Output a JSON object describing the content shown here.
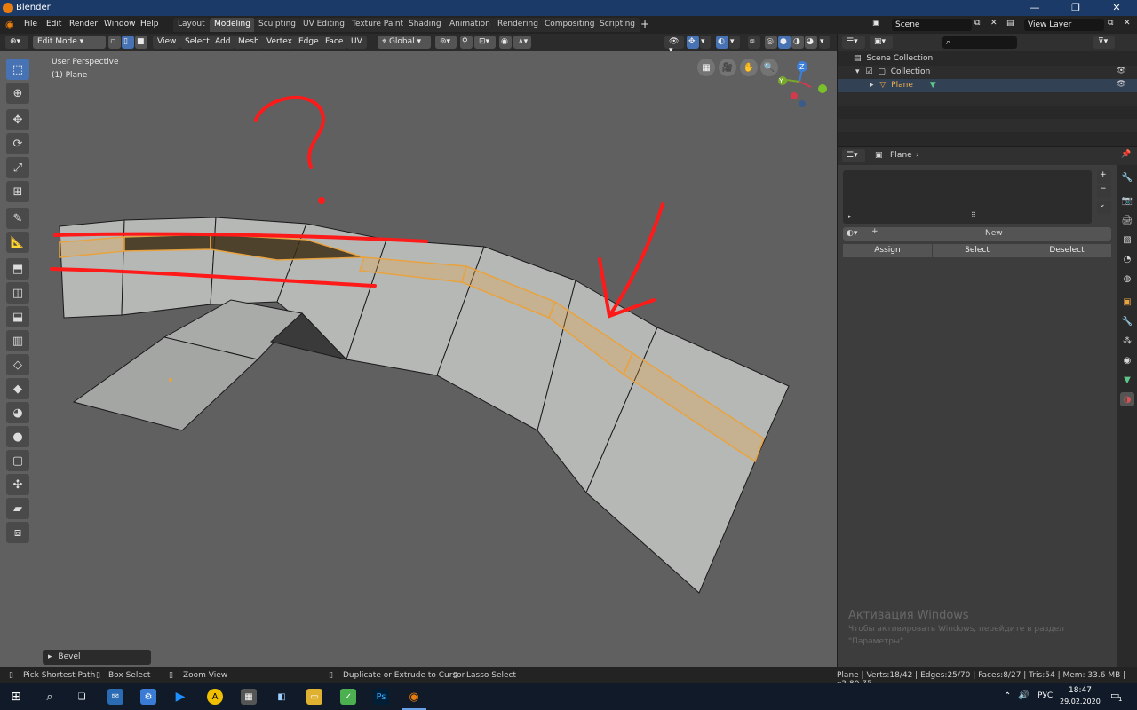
{
  "window": {
    "title": "Blender",
    "minimize": "—",
    "maximize": "❐",
    "close": "✕"
  },
  "menu": {
    "items": [
      "File",
      "Edit",
      "Render",
      "Window",
      "Help"
    ]
  },
  "workspaces": [
    "Layout",
    "Modeling",
    "Sculpting",
    "UV Editing",
    "Texture Paint",
    "Shading",
    "Animation",
    "Rendering",
    "Compositing",
    "Scripting"
  ],
  "workspace_add": "+",
  "scene": {
    "name": "Scene",
    "view_layer": "View Layer"
  },
  "viewport_header": {
    "mode": "Edit Mode",
    "menus": [
      "View",
      "Select",
      "Add",
      "Mesh",
      "Vertex",
      "Edge",
      "Face",
      "UV"
    ],
    "orientation": "Global"
  },
  "viewport": {
    "perspective_label": "User Perspective",
    "object_label": "(1) Plane",
    "gizmo": {
      "z": "Z",
      "y": "Y",
      "x": "X"
    }
  },
  "last_operator": {
    "name": "Bevel",
    "arrow": "▸"
  },
  "outliner": {
    "root": "Scene Collection",
    "collection": "Collection",
    "object": "Plane"
  },
  "properties": {
    "object_name": "Plane",
    "new_button": "New",
    "add_icon": "+",
    "minus_icon": "−",
    "assign": "Assign",
    "select": "Select",
    "deselect": "Deselect"
  },
  "activation_watermark": {
    "line1": "Активация Windows",
    "line2": "Чтобы активировать Windows, перейдите в раздел",
    "line3": "\"Параметры\"."
  },
  "status_bar": {
    "left": [
      "Pick Shortest Path",
      "Box Select",
      "Zoom View",
      "Duplicate or Extrude to Cursor",
      "Lasso Select"
    ],
    "stats": "Plane | Verts:18/42 | Edges:25/70 | Faces:8/27 | Tris:54 | Mem: 33.6 MB | v2.80.75"
  },
  "taskbar": {
    "time": "18:47",
    "date": "29.02.2020",
    "lang": "РУС",
    "notif_count": "1"
  },
  "colors": {
    "accent_blue": "#4772b3",
    "selection_orange": "#e8a340",
    "annotation_red": "#ff1a1a",
    "mesh_face": "#b5b7b5"
  }
}
